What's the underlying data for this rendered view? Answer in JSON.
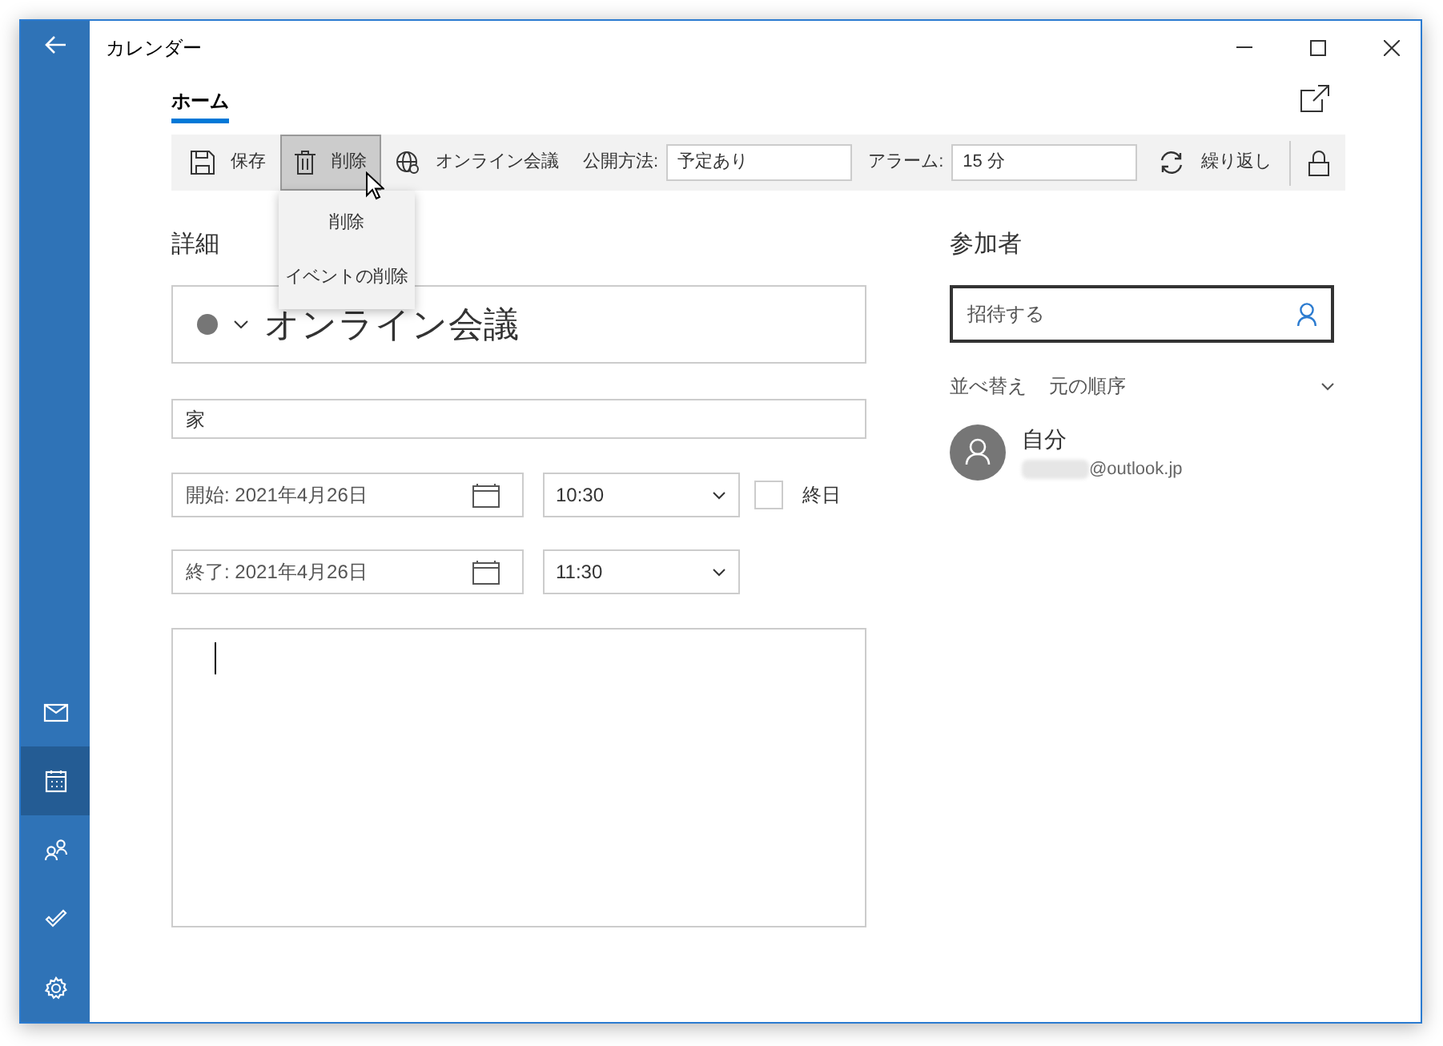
{
  "window": {
    "title": "カレンダー"
  },
  "nav": [
    {
      "kind": "mail",
      "selected": false
    },
    {
      "kind": "calendar",
      "selected": true
    },
    {
      "kind": "people",
      "selected": false
    },
    {
      "kind": "todo",
      "selected": false
    },
    {
      "kind": "settings",
      "selected": false
    }
  ],
  "tabs": [
    {
      "label": "ホーム",
      "selected": true
    }
  ],
  "toolbar": [
    {
      "kind": "button",
      "label": "保存",
      "pressed": false
    },
    {
      "kind": "button",
      "label": "削除",
      "pressed": true
    },
    {
      "kind": "button",
      "label": "オンライン会議",
      "pressed": false
    },
    {
      "kind": "field",
      "label": "公開方法:",
      "value": "予定あり"
    },
    {
      "kind": "field",
      "label": "アラーム:",
      "value": "15 分"
    },
    {
      "kind": "button",
      "label": "繰り返し",
      "pressed": false
    },
    {
      "kind": "lock"
    }
  ],
  "delete_menu": [
    "削除",
    "イベントの削除"
  ],
  "details": {
    "heading": "詳細",
    "color": "#767676",
    "title": "オンライン会議",
    "location": "家",
    "start": {
      "date": "開始: 2021年4月26日",
      "time": "10:30"
    },
    "end": {
      "date": "終了: 2021年4月26日",
      "time": "11:30"
    },
    "all_day": {
      "label": "終日",
      "checked": false
    }
  },
  "attendees": {
    "heading": "参加者",
    "invite_placeholder": "招待する",
    "sort_label": "並べ替え",
    "sort_value": "元の順序",
    "people": [
      {
        "name": "自分",
        "email": "@outlook.jp"
      }
    ]
  }
}
